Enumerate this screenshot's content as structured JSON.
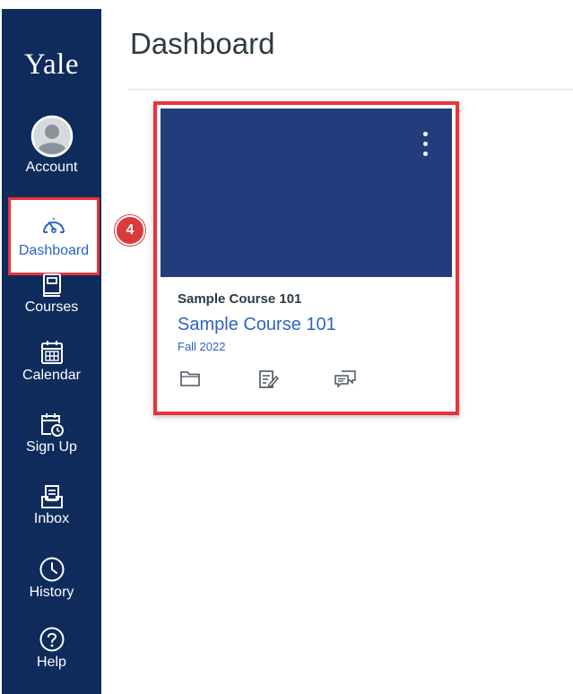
{
  "sidebar": {
    "logo": "Yale",
    "items": [
      {
        "label": "Account",
        "icon": "account-avatar-icon"
      },
      {
        "label": "Dashboard",
        "icon": "dashboard-gauge-icon",
        "active": true
      },
      {
        "label": "Courses",
        "icon": "courses-book-icon"
      },
      {
        "label": "Calendar",
        "icon": "calendar-icon"
      },
      {
        "label": "Sign Up",
        "icon": "sign-up-calendar-clock-icon"
      },
      {
        "label": "Inbox",
        "icon": "inbox-icon"
      },
      {
        "label": "History",
        "icon": "history-clock-icon"
      },
      {
        "label": "Help",
        "icon": "help-question-icon"
      }
    ]
  },
  "callout": {
    "step": "4"
  },
  "main": {
    "title": "Dashboard",
    "card": {
      "subtitle": "Sample Course 101",
      "title": "Sample Course 101",
      "term": "Fall 2022",
      "actions": [
        {
          "icon": "folder-icon"
        },
        {
          "icon": "assignments-edit-icon"
        },
        {
          "icon": "discussions-chat-icon"
        }
      ]
    }
  },
  "colors": {
    "sidebar_bg": "#0e2b5c",
    "card_hero": "#233d7c",
    "link_blue": "#2e63c2",
    "highlight_red": "#e8333a"
  }
}
